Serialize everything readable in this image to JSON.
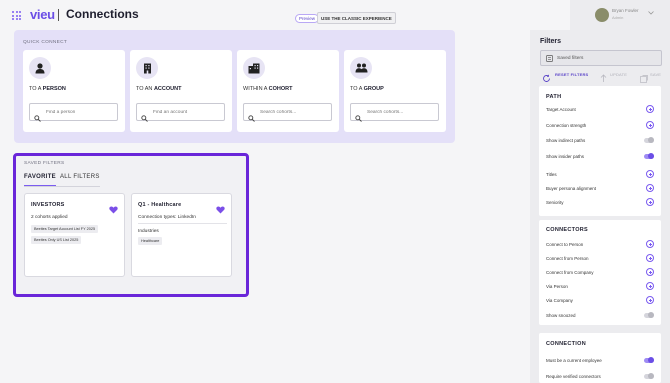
{
  "header": {
    "logo": "vieu",
    "title": "Connections",
    "preview_badge": "Preview",
    "classic_button": "USE THE CLASSIC EXPERIENCE"
  },
  "user": {
    "name": "Bryan Fowler",
    "role": "Admin"
  },
  "quick_connect": {
    "label": "QUICK CONNECT",
    "cards": [
      {
        "prefix": "TO A ",
        "bold": "PERSON",
        "placeholder": "Find a person",
        "icon": "person-icon"
      },
      {
        "prefix": "TO AN ",
        "bold": "ACCOUNT",
        "placeholder": "Find an account",
        "icon": "building-icon"
      },
      {
        "prefix": "WITHIN A ",
        "bold": "COHORT",
        "placeholder": "Search cohorts...",
        "icon": "buildings-icon"
      },
      {
        "prefix": "TO A ",
        "bold": "GROUP",
        "placeholder": "Search cohorts...",
        "icon": "group-icon"
      }
    ]
  },
  "saved_filters": {
    "label": "SAVED FILTERS",
    "tabs": [
      "FAVORITE",
      "ALL FILTERS"
    ],
    "cards": [
      {
        "title": "INVESTORS",
        "line": "2 cohorts applied",
        "chips": [
          "Beeites Target Account List FY 2025",
          "Beeites Only US List 2025"
        ]
      },
      {
        "title": "Q1 - Healthcare",
        "line": "Connection types: LinkedIn",
        "sub": "Industries",
        "chips": [
          "Healthcare"
        ]
      }
    ]
  },
  "filters": {
    "title": "Filters",
    "saved_placeholder": "Saved filters",
    "actions": {
      "reset": "RESET FILTERS",
      "update": "UPDATE",
      "save": "SAVE"
    },
    "path": {
      "heading": "PATH",
      "rows": [
        {
          "label": "Target Account",
          "control": "plus"
        },
        {
          "label": "Connection strength",
          "control": "plus"
        },
        {
          "label": "Show indirect paths",
          "control": "toggle",
          "on": false
        },
        {
          "label": "Show insider paths",
          "control": "toggle",
          "on": true
        },
        {
          "label": "Titles",
          "control": "plus"
        },
        {
          "label": "Buyer persona alignment",
          "control": "plus"
        },
        {
          "label": "Seniority",
          "control": "plus"
        }
      ]
    },
    "connectors": {
      "heading": "CONNECTORS",
      "rows": [
        {
          "label": "Connect to Person",
          "control": "plus"
        },
        {
          "label": "Connect from Person",
          "control": "plus"
        },
        {
          "label": "Connect from Company",
          "control": "plus"
        },
        {
          "label": "Via Person",
          "control": "plus"
        },
        {
          "label": "Via Company",
          "control": "plus"
        },
        {
          "label": "Show snoozed",
          "control": "toggle",
          "on": false
        }
      ]
    },
    "connection": {
      "heading": "CONNECTION",
      "rows": [
        {
          "label": "Must be a current employee",
          "control": "toggle",
          "on": true
        },
        {
          "label": "Require verified connectors",
          "control": "toggle",
          "on": false
        }
      ]
    }
  },
  "colors": {
    "accent": "#6b4ee6",
    "highlight_border": "#6a26d9",
    "quick_connect_bg": "#e4e0f8"
  }
}
